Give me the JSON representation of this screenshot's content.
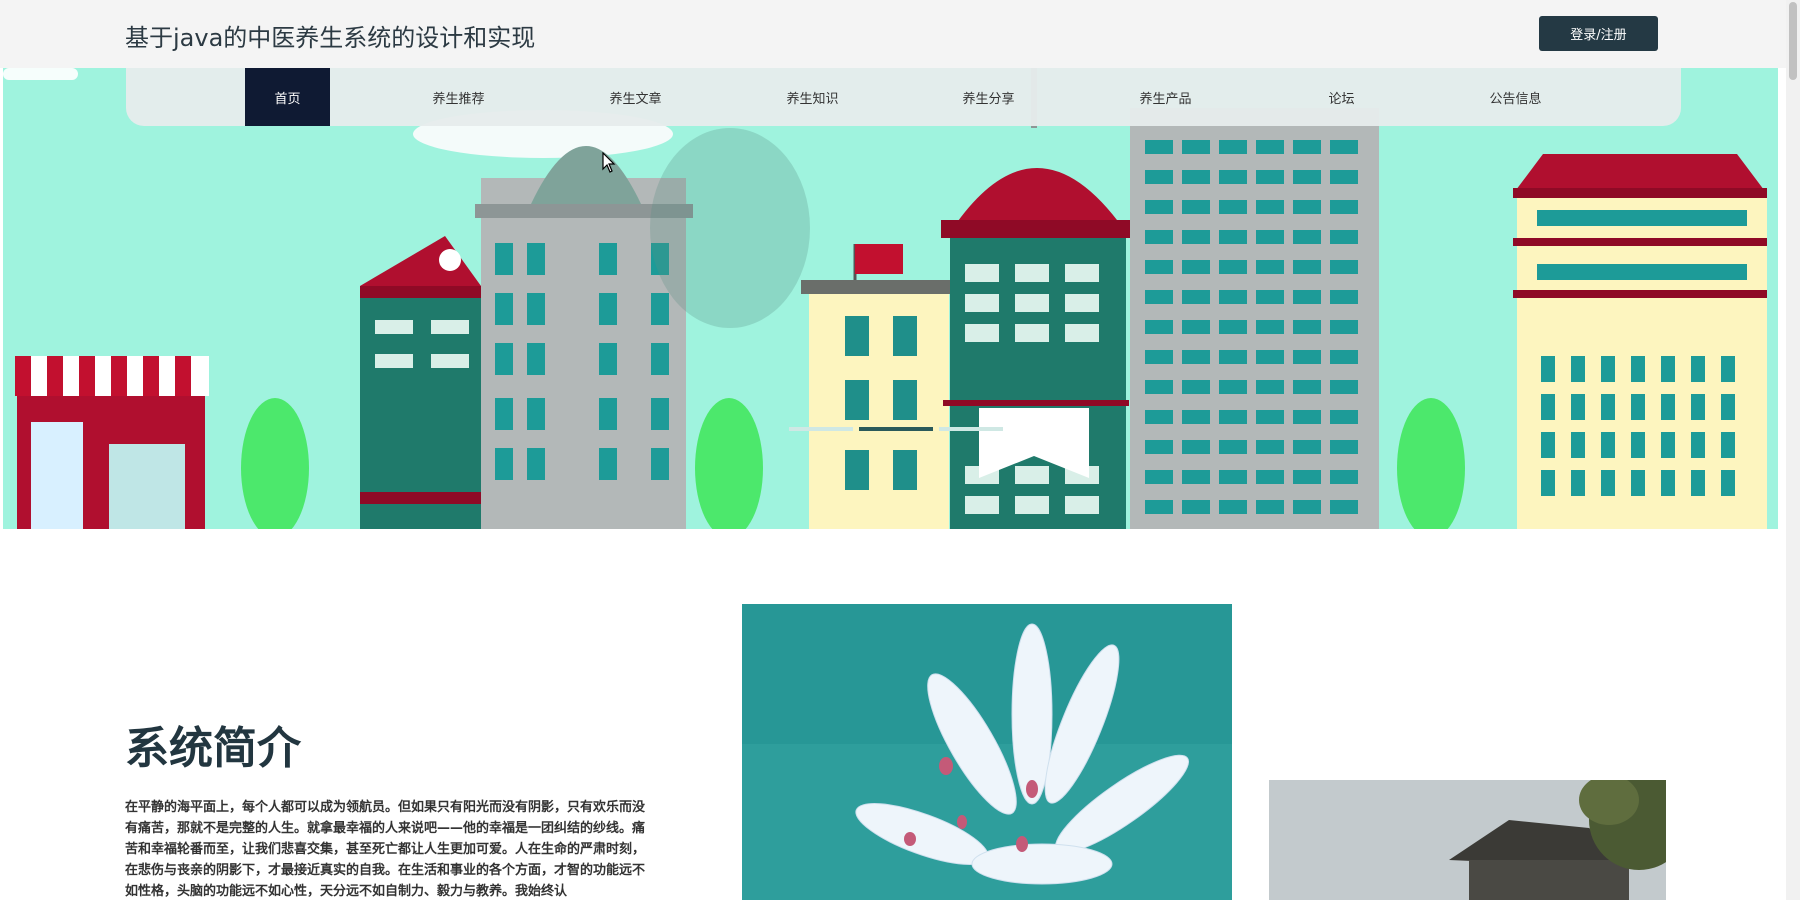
{
  "header": {
    "title": "基于java的中医养生系统的设计和实现",
    "login_label": "登录/注册"
  },
  "nav": {
    "items": [
      {
        "label": "首页",
        "active": true
      },
      {
        "label": "养生推荐"
      },
      {
        "label": "养生文章"
      },
      {
        "label": "养生知识"
      },
      {
        "label": "养生分享"
      },
      {
        "label": "养生产品"
      },
      {
        "label": "论坛"
      },
      {
        "label": "公告信息"
      }
    ]
  },
  "intro": {
    "title": "系统简介",
    "text": "在平静的海平面上，每个人都可以成为领航员。但如果只有阳光而没有阴影，只有欢乐而没有痛苦，那就不是完整的人生。就拿最幸福的人来说吧——他的幸福是一团纠结的纱线。痛苦和幸福轮番而至，让我们悲喜交集，甚至死亡都让人生更加可爱。人在生命的严肃时刻，在悲伤与丧亲的阴影下，才最接近真实的自我。在生活和事业的各个方面，才智的功能远不如性格，头脑的功能远不如心性，天分远不如自制力、毅力与教养。我始终认"
  },
  "colors": {
    "header_bg": "#f4f4f4",
    "login_bg": "#243944",
    "nav_active_bg": "#0f1a33",
    "banner_sky": "#9ff3de",
    "title_color": "#223640"
  },
  "icons": {
    "cursor": "mouse-pointer-icon"
  }
}
